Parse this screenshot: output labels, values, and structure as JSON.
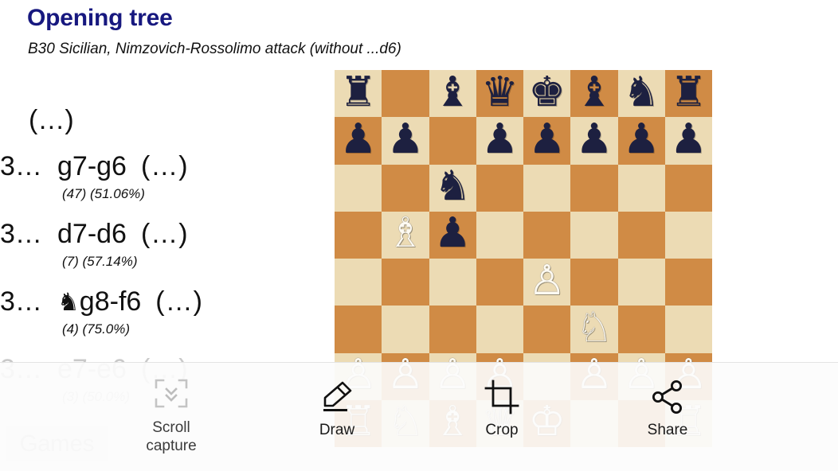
{
  "header": {
    "title": "Opening tree",
    "subtitle": "B30 Sicilian, Nimzovich-Rossolimo attack (without ...d6)"
  },
  "movelist": {
    "root_label": "(…)",
    "rows": [
      {
        "number": "3…",
        "piece_glyph": "",
        "san": "g7-g6",
        "continuation": "(…)",
        "games": "(47)",
        "score": "(51.06%)",
        "faded": false
      },
      {
        "number": "3…",
        "piece_glyph": "",
        "san": "d7-d6",
        "continuation": "(…)",
        "games": "(7)",
        "score": "(57.14%)",
        "faded": false
      },
      {
        "number": "3…",
        "piece_glyph": "♞",
        "san": "g8-f6",
        "continuation": "(…)",
        "games": "(4)",
        "score": "(75.0%)",
        "faded": false
      },
      {
        "number": "3…",
        "piece_glyph": "",
        "san": "e7-e6",
        "continuation": "(…)",
        "games": "(3)",
        "score": "(50.0%)",
        "faded": true
      }
    ],
    "games_button_label": "Games"
  },
  "board": {
    "light_color": "#ecdbb4",
    "dark_color": "#d08b45",
    "ranks": [
      [
        "r",
        "",
        "b",
        "q",
        "k",
        "b",
        "n",
        "r"
      ],
      [
        "p",
        "p",
        "",
        "p",
        "p",
        "p",
        "p",
        "p"
      ],
      [
        "",
        "",
        "n",
        "",
        "",
        "",
        "",
        ""
      ],
      [
        "",
        "B",
        "p",
        "",
        "",
        "",
        "",
        ""
      ],
      [
        "",
        "",
        "",
        "",
        "P",
        "",
        "",
        ""
      ],
      [
        "",
        "",
        "",
        "",
        "",
        "N",
        "",
        ""
      ],
      [
        "P",
        "P",
        "P",
        "P",
        "",
        "P",
        "P",
        "P"
      ],
      [
        "R",
        "N",
        "B",
        "Q",
        "K",
        "",
        "",
        "R"
      ]
    ]
  },
  "overlay": {
    "tools": [
      {
        "label": "Scroll\ncapture",
        "label_line1": "Scroll",
        "label_line2": "capture",
        "icon": "scroll-capture-icon"
      },
      {
        "label": "Draw",
        "icon": "pencil-icon"
      },
      {
        "label": "Crop",
        "icon": "crop-icon"
      },
      {
        "label": "Share",
        "icon": "share-icon"
      }
    ]
  }
}
